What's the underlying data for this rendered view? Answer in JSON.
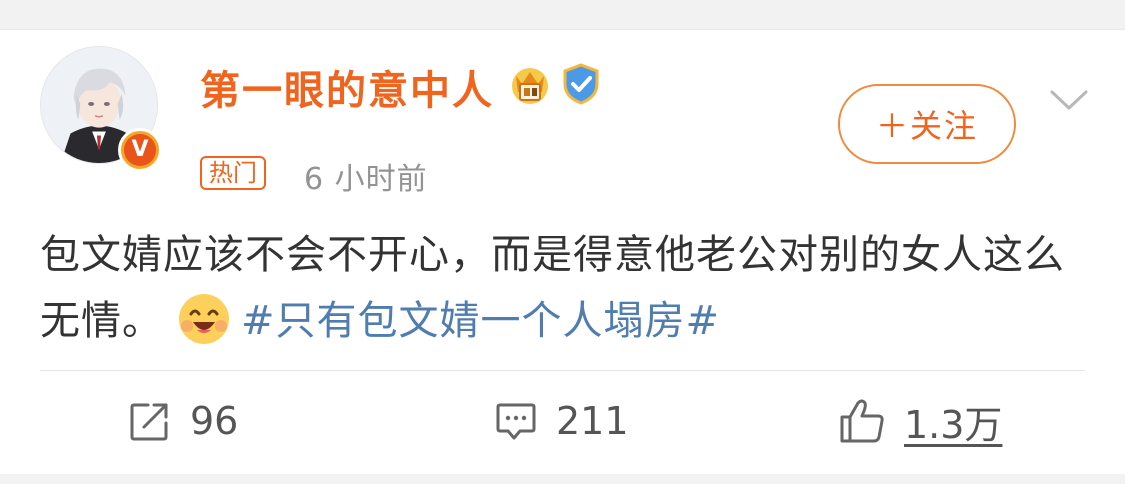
{
  "post": {
    "username": "第一眼的意中人",
    "hot_tag": "热门",
    "time": "6 小时前",
    "follow_label": "＋关注",
    "content_text": "包文婧应该不会不开心，而是得意他老公对别的女人这么无情。",
    "hashtag": "#只有包文婧一个人塌房#"
  },
  "actions": {
    "repost_count": "96",
    "comment_count": "211",
    "like_count": "1.3万"
  },
  "colors": {
    "username": "#f0641e",
    "hashtag": "#507daf",
    "text": "#333333",
    "muted": "#939393"
  },
  "icons": {
    "crown": "crown-badge-icon",
    "shield": "verified-shield-icon",
    "chevron": "chevron-down-icon",
    "emoji": "grinning-emoji-icon",
    "repost": "repost-icon",
    "comment": "comment-icon",
    "like": "thumbs-up-icon",
    "avatar_badge": "v-badge-icon"
  }
}
